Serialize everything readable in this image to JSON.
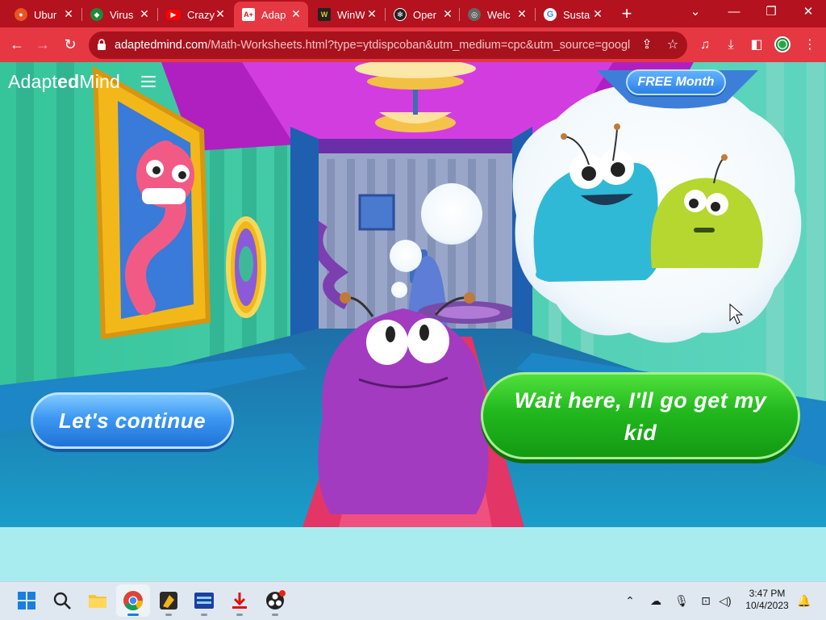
{
  "tabs": [
    {
      "title": "Ubur",
      "icon": "ubuntu-icon",
      "color": "#e95420",
      "active": false
    },
    {
      "title": "Virus",
      "icon": "virus-shield-icon",
      "color": "#1c8a3a",
      "active": false
    },
    {
      "title": "Crazy",
      "icon": "youtube-icon",
      "color": "#ff0000",
      "active": false
    },
    {
      "title": "Adap",
      "icon": "adaptedmind-icon",
      "color": "#ffffff",
      "active": true
    },
    {
      "title": "WinW",
      "icon": "winworld-icon",
      "color": "#222222",
      "active": false
    },
    {
      "title": "Oper",
      "icon": "openai-icon",
      "color": "#222222",
      "active": false
    },
    {
      "title": "Welc",
      "icon": "globe-icon",
      "color": "#555555",
      "active": false
    },
    {
      "title": "Sustai",
      "icon": "google-icon",
      "color": "#4285f4",
      "active": false
    }
  ],
  "toolbar": {
    "url_host": "adaptedmind.com",
    "url_rest": "/Math-Worksheets.html?type=ytdispcoban&utm_medium=cpc&utm_source=googl..."
  },
  "page": {
    "brand_light": "Adapt",
    "brand_bold": "ed",
    "brand_tail": "Mind",
    "free_month": "FREE Month",
    "continue_label": "Let's continue",
    "wait_label": "Wait here, I'll go get my kid"
  },
  "taskbar": {
    "time": "3:47 PM",
    "date": "10/4/2023",
    "apps": [
      "windows-start-icon",
      "search-icon",
      "file-explorer-icon",
      "chrome-icon",
      "app-icon",
      "network-app-icon",
      "acrobat-icon",
      "obs-icon"
    ]
  },
  "colors": {
    "tabstrip": "#b3121e",
    "toolbar": "#e53843",
    "continue_button": "#3d98f2",
    "wait_button": "#22b81e"
  }
}
